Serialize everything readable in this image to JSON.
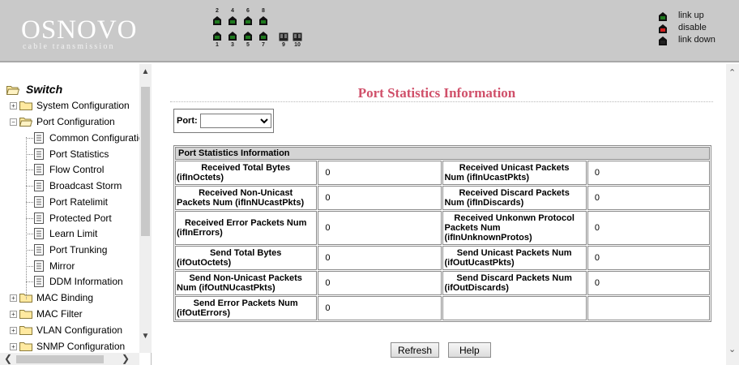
{
  "header": {
    "logo_name": "OSNOVO",
    "logo_sub": "cable transmission",
    "ports_top": [
      {
        "num": "2",
        "status": "up"
      },
      {
        "num": "4",
        "status": "up"
      },
      {
        "num": "6",
        "status": "up"
      },
      {
        "num": "8",
        "status": "up"
      }
    ],
    "ports_bottom": [
      {
        "num": "1",
        "status": "up"
      },
      {
        "num": "3",
        "status": "up"
      },
      {
        "num": "5",
        "status": "up"
      },
      {
        "num": "7",
        "status": "up"
      }
    ],
    "ports_sfp": [
      {
        "num": "9",
        "status": "down"
      },
      {
        "num": "10",
        "status": "down"
      }
    ],
    "legend": [
      {
        "label": "link up",
        "color": "#1f7a1f"
      },
      {
        "label": "disable",
        "color": "#d42020"
      },
      {
        "label": "link down",
        "color": "#222222"
      }
    ]
  },
  "sidebar": {
    "root": "Switch",
    "items": [
      {
        "label": "System Configuration",
        "level": 1,
        "kind": "folder",
        "expanded": false
      },
      {
        "label": "Port Configuration",
        "level": 1,
        "kind": "folder",
        "expanded": true
      },
      {
        "label": "Common Configuratio",
        "level": 2,
        "kind": "page"
      },
      {
        "label": "Port Statistics",
        "level": 2,
        "kind": "page"
      },
      {
        "label": "Flow Control",
        "level": 2,
        "kind": "page"
      },
      {
        "label": "Broadcast Storm",
        "level": 2,
        "kind": "page"
      },
      {
        "label": "Port Ratelimit",
        "level": 2,
        "kind": "page"
      },
      {
        "label": "Protected Port",
        "level": 2,
        "kind": "page"
      },
      {
        "label": "Learn Limit",
        "level": 2,
        "kind": "page"
      },
      {
        "label": "Port Trunking",
        "level": 2,
        "kind": "page"
      },
      {
        "label": "Mirror",
        "level": 2,
        "kind": "page"
      },
      {
        "label": "DDM Information",
        "level": 2,
        "kind": "page"
      },
      {
        "label": "MAC Binding",
        "level": 1,
        "kind": "folder",
        "expanded": false
      },
      {
        "label": "MAC Filter",
        "level": 1,
        "kind": "folder",
        "expanded": false
      },
      {
        "label": "VLAN Configuration",
        "level": 1,
        "kind": "folder",
        "expanded": false
      },
      {
        "label": "SNMP Configuration",
        "level": 1,
        "kind": "folder",
        "expanded": false
      }
    ]
  },
  "main": {
    "title": "Port Statistics Information",
    "port_label": "Port:",
    "port_value": "",
    "table_header": "Port Statistics Information",
    "rows": [
      [
        {
          "l1": "Received Total Bytes",
          "l2": "(ifInOctets)",
          "value": "0"
        },
        {
          "l1": "Received Unicast Packets",
          "l2": "Num (ifInUcastPkts)",
          "value": "0"
        }
      ],
      [
        {
          "l1": "Received Non-Unicast",
          "l2": "Packets Num (ifInNUcastPkts)",
          "value": "0"
        },
        {
          "l1": "Received Discard Packets",
          "l2": "Num (ifInDiscards)",
          "value": "0"
        }
      ],
      [
        {
          "l1": "Received Error Packets Num",
          "l2": "(ifInErrors)",
          "value": "0"
        },
        {
          "l1": "Received Unkonwn Protocol",
          "l2": "Packets Num",
          "l3": "(ifInUnknownProtos)",
          "value": "0"
        }
      ],
      [
        {
          "l1": "Send Total Bytes",
          "l2": "(ifOutOctets)",
          "value": "0"
        },
        {
          "l1": "Send Unicast Packets Num",
          "l2": "(ifOutUcastPkts)",
          "value": "0"
        }
      ],
      [
        {
          "l1": "Send Non-Unicast Packets",
          "l2": "Num (ifOutNUcastPkts)",
          "value": "0"
        },
        {
          "l1": "Send Discard Packets Num",
          "l2": "(ifOutDiscards)",
          "value": "0"
        }
      ],
      [
        {
          "l1": "Send Error Packets Num",
          "l2": "(ifOutErrors)",
          "value": "0"
        },
        {
          "l1": "",
          "l2": "",
          "value": ""
        }
      ]
    ],
    "refresh_label": "Refresh",
    "help_label": "Help"
  }
}
